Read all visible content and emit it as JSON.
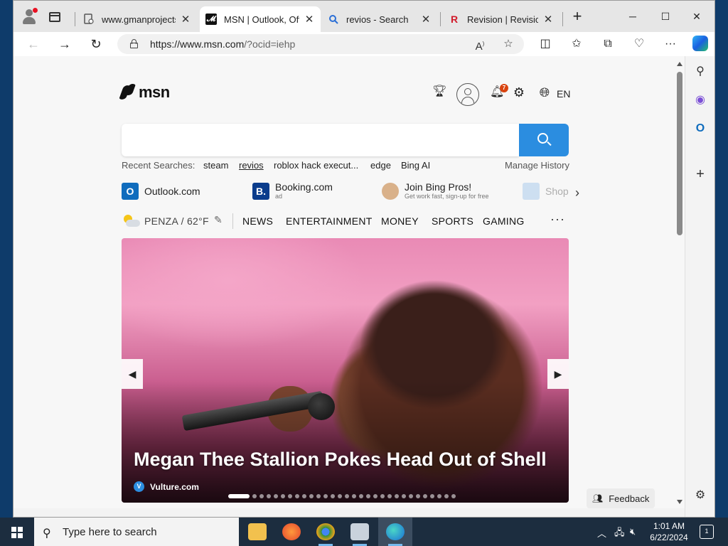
{
  "browser": {
    "tabs": [
      {
        "title": "www.gmanprojects.",
        "active": false
      },
      {
        "title": "MSN | Outlook, Offi",
        "active": true
      },
      {
        "title": "revios - Search",
        "active": false
      },
      {
        "title": "Revision | Revision",
        "active": false
      }
    ],
    "address": {
      "host": "https://www.msn.com",
      "path": "/?ocid=iehp"
    }
  },
  "msn": {
    "logo_text": "msn",
    "notification_count": "7",
    "language": "EN",
    "search": {
      "placeholder": "",
      "recent_label": "Recent Searches:",
      "recent": [
        "steam",
        "revios",
        "roblox hack execut...",
        "edge",
        "Bing AI"
      ],
      "manage_history": "Manage History"
    },
    "quick_links": [
      {
        "label": "Outlook.com",
        "sub": ""
      },
      {
        "label": "Booking.com",
        "sub": "ad"
      },
      {
        "label": "Join Bing Pros!",
        "sub": "Get work fast, sign-up for free"
      },
      {
        "label": "Shop",
        "sub": ""
      }
    ],
    "weather": {
      "location": "PENZA",
      "temp": "62°F",
      "text": "PENZA / 62°F"
    },
    "nav": [
      "NEWS",
      "ENTERTAINMENT",
      "MONEY",
      "SPORTS",
      "GAMING"
    ],
    "more": "···",
    "hero": {
      "title": "Megan Thee Stallion Pokes Head Out of Shell",
      "source": "Vulture.com",
      "slide_index": 1,
      "slide_count": 30
    },
    "feedback": "Feedback"
  },
  "taskbar": {
    "search_placeholder": "Type here to search",
    "time": "1:01 AM",
    "date": "6/22/2024",
    "notification_count": "1"
  },
  "colors": {
    "search_button": "#2b8de0",
    "badge": "#d9430f",
    "taskbar": "#1c2d3f"
  }
}
